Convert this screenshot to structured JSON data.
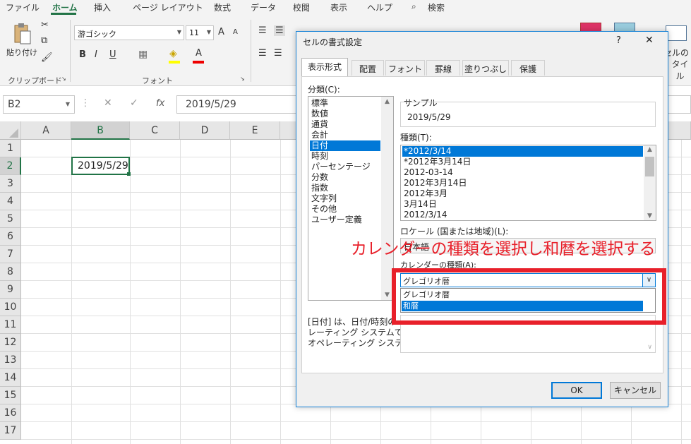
{
  "ribbon": {
    "tabs": [
      "ファイル",
      "ホーム",
      "挿入",
      "ページ レイアウト",
      "数式",
      "データ",
      "校閲",
      "表示",
      "ヘルプ"
    ],
    "search_label": "検索",
    "paste_label": "貼り付け",
    "clipboard_label": "クリップボード",
    "font_name": "游ゴシック",
    "font_size": "11",
    "font_group_label": "フォント",
    "bold": "B",
    "italic": "I",
    "underline": "U",
    "grow_font": "A",
    "shrink_font": "A",
    "font_color_letter": "A",
    "cell_style_line1": "セルの",
    "cell_style_line2": "タイル"
  },
  "formula_bar": {
    "name_box": "B2",
    "fx": "fx",
    "value": "2019/5/29"
  },
  "sheet": {
    "columns": [
      "A",
      "B",
      "C",
      "D",
      "E"
    ],
    "rows": [
      "1",
      "2",
      "3",
      "4",
      "5",
      "6",
      "7",
      "8",
      "9",
      "10",
      "11",
      "12",
      "13",
      "14",
      "15",
      "16",
      "17"
    ],
    "b2": "2019/5/29"
  },
  "dialog": {
    "title": "セルの書式設定",
    "help": "?",
    "close": "✕",
    "tabs": [
      "表示形式",
      "配置",
      "フォント",
      "罫線",
      "塗りつぶし",
      "保護"
    ],
    "category_label": "分類(C):",
    "categories": [
      "標準",
      "数値",
      "通貨",
      "会計",
      "日付",
      "時刻",
      "パーセンテージ",
      "分数",
      "指数",
      "文字列",
      "その他",
      "ユーザー定義"
    ],
    "sample_label": "サンプル",
    "sample_value": "2019/5/29",
    "type_label": "種類(T):",
    "types": [
      "*2012/3/14",
      "*2012年3月14日",
      "2012-03-14",
      "2012年3月14日",
      "2012年3月",
      "3月14日",
      "2012/3/14"
    ],
    "locale_label": "ロケール (国または地域)(L):",
    "locale_value": "日本語",
    "calendar_label": "カレンダーの種類(A):",
    "calendar_value": "グレゴリオ暦",
    "calendar_options": [
      "グレゴリオ暦",
      "和暦"
    ],
    "desc_line1": "[日付] は、日付/時刻の",
    "desc_line2": "レーティング システムで指定",
    "desc_line3": "オペレーティング システムの設",
    "ok": "OK",
    "cancel": "キャンセル"
  },
  "annotation": "カレンダーの種類を選択し和暦を選択する",
  "colors": {
    "excel_green": "#217346",
    "selection_blue": "#0078d7",
    "annotation_red": "#e8202a"
  }
}
